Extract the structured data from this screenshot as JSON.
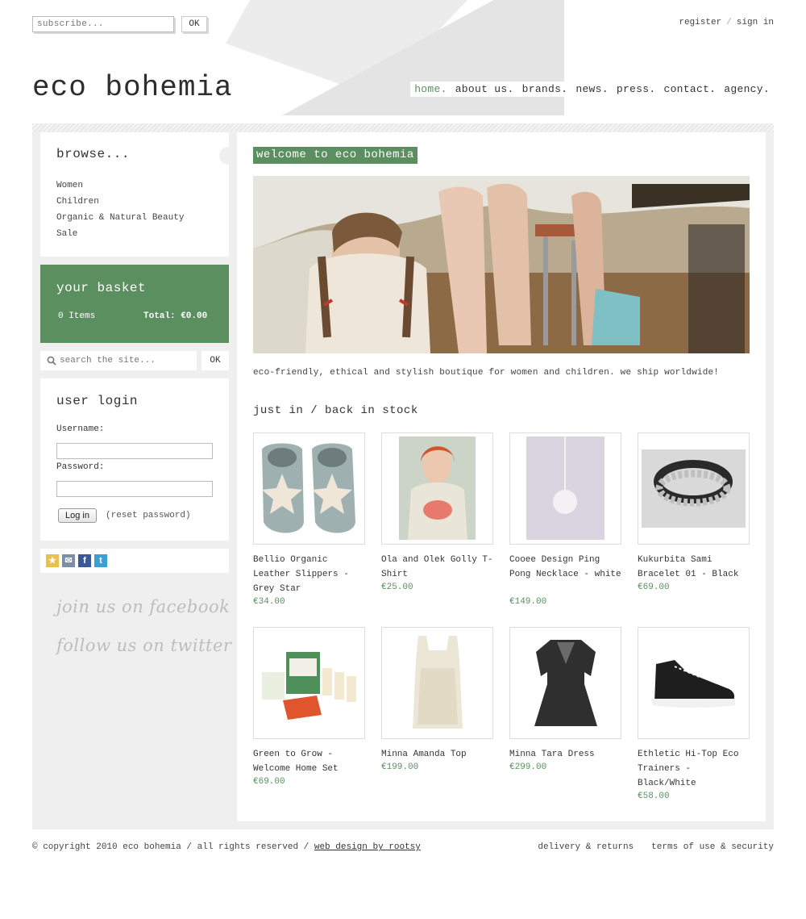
{
  "header": {
    "subscribe_placeholder": "subscribe...",
    "subscribe_button": "OK",
    "register": "register",
    "separator": "/",
    "sign_in": "sign in",
    "logo": "eco bohemia",
    "nav": [
      {
        "label": "home.",
        "active": true
      },
      {
        "label": "about us.",
        "active": false
      },
      {
        "label": "brands.",
        "active": false
      },
      {
        "label": "news.",
        "active": false
      },
      {
        "label": "press.",
        "active": false
      },
      {
        "label": "contact.",
        "active": false
      },
      {
        "label": "agency.",
        "active": false
      }
    ]
  },
  "sidebar": {
    "browse_title": "browse...",
    "browse_items": [
      "Women",
      "Children",
      "Organic & Natural Beauty",
      "Sale"
    ],
    "basket_title": "your basket",
    "basket_items": "0 Items",
    "basket_total": "Total: €0.00",
    "search_placeholder": "search the site...",
    "search_button": "OK",
    "login_title": "user login",
    "username_label": "Username:",
    "password_label": "Password:",
    "login_button": "Log in",
    "reset_password": "(reset password)",
    "facebook_text": "join us on facebook",
    "twitter_text": "follow us on twitter"
  },
  "main": {
    "welcome_title": "welcome to eco bohemia",
    "tagline": "eco-friendly, ethical and stylish boutique for women and children. we ship worldwide!",
    "section_title": "just in / back in stock",
    "products": [
      {
        "name": "Bellio Organic Leather Slippers - Grey Star",
        "price": "€34.00"
      },
      {
        "name": "Ola and Olek Golly T-Shirt",
        "price": "€25.00"
      },
      {
        "name": "Cooee Design Ping Pong Necklace - white",
        "price": "€149.00"
      },
      {
        "name": "Kukurbita Sami Bracelet 01 - Black",
        "price": "€69.00"
      },
      {
        "name": "Green to Grow - Welcome Home Set",
        "price": "€69.00"
      },
      {
        "name": "Minna Amanda Top",
        "price": "€199.00"
      },
      {
        "name": "Minna Tara Dress",
        "price": "€299.00"
      },
      {
        "name": "Ethletic Hi-Top Eco Trainers - Black/White",
        "price": "€58.00"
      }
    ]
  },
  "footer": {
    "copyright": "© copyright 2010 eco bohemia / all rights reserved / ",
    "credit": "web design by rootsy",
    "delivery": "delivery & returns",
    "terms": "terms of use & security"
  },
  "colors": {
    "accent": "#5b8f60",
    "frame": "#efefef"
  }
}
